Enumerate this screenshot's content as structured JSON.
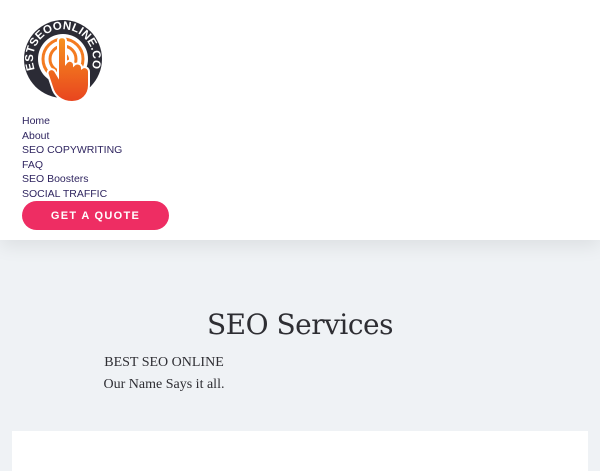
{
  "logo": {
    "text": "BESTSEOONLINE.COM",
    "icon": "pointing-hand-icon",
    "colors": {
      "ring": "#2b2b35",
      "accent": "#f47b20",
      "accent_dark": "#e8441f"
    }
  },
  "nav": {
    "items": [
      {
        "label": "Home"
      },
      {
        "label": "About"
      },
      {
        "label": "SEO COPYWRITING"
      },
      {
        "label": "FAQ"
      },
      {
        "label": "SEO Boosters"
      },
      {
        "label": "SOCIAL TRAFFIC"
      }
    ]
  },
  "cta": {
    "label": "GET A QUOTE",
    "color": "#ee2d63"
  },
  "hero": {
    "title": "SEO Services",
    "subtitle1": "BEST SEO ONLINE",
    "subtitle2": "Our Name Says it all."
  }
}
